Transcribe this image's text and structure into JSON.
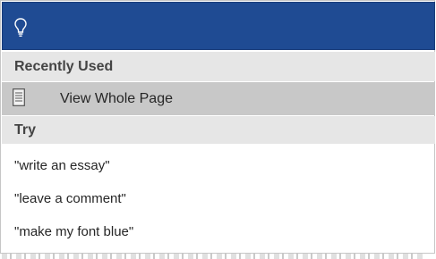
{
  "search": {
    "icon": "lightbulb-icon"
  },
  "recently_used": {
    "header": "Recently Used",
    "items": [
      {
        "icon": "page-icon",
        "label": "View Whole Page"
      }
    ]
  },
  "try": {
    "header": "Try",
    "suggestions": [
      "\"write an essay\"",
      "\"leave a comment\"",
      "\"make my font blue\""
    ]
  },
  "colors": {
    "search_bar": "#1f4b93",
    "section_header_bg": "#e6e6e6",
    "selected_item_bg": "#c8c8c8"
  }
}
